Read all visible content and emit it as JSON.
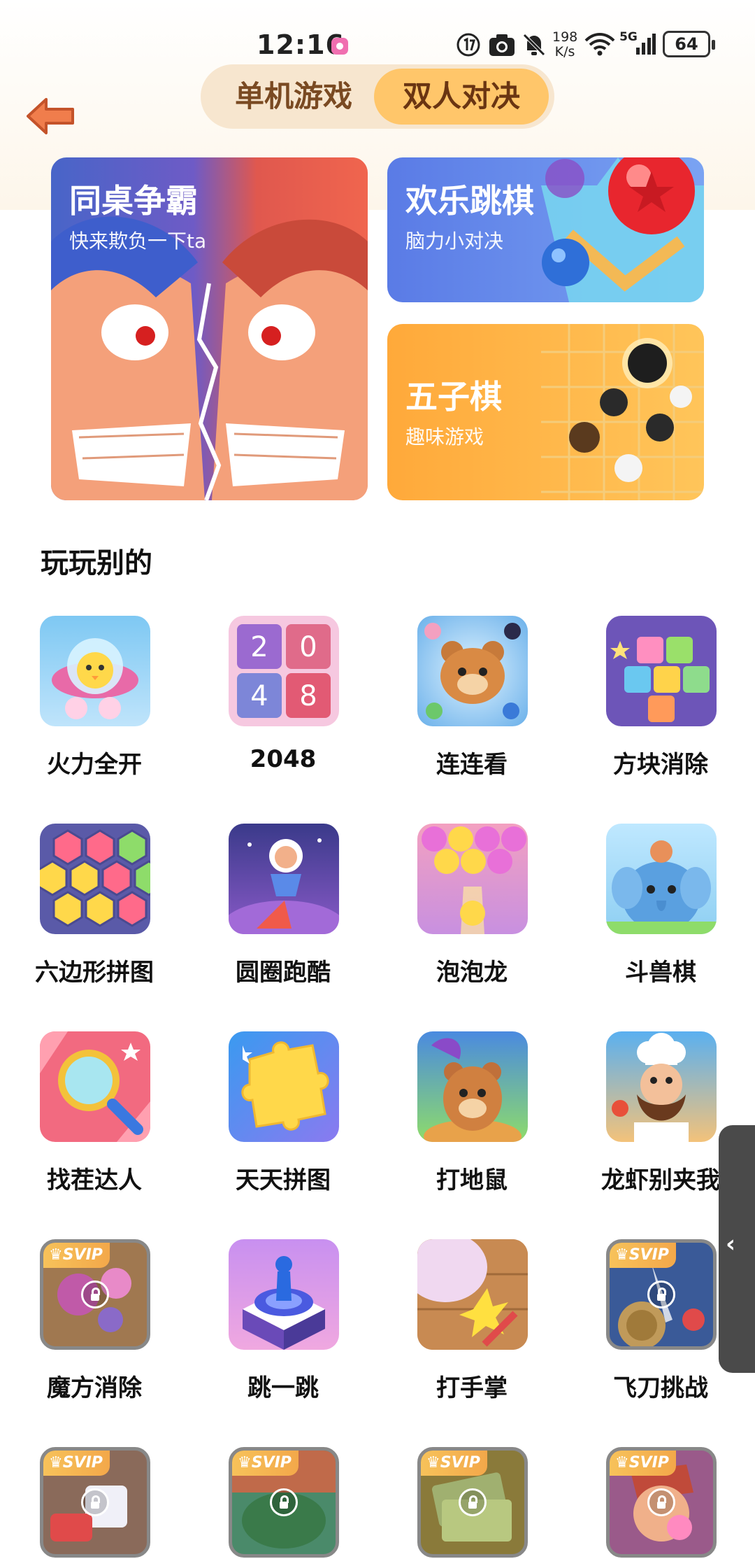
{
  "status_bar": {
    "time": "12:16",
    "net_speed_value": "198",
    "net_speed_unit": "K/s",
    "network": "5G",
    "battery": "64"
  },
  "header": {
    "tabs": [
      {
        "label": "单机游戏",
        "selected": false
      },
      {
        "label": "双人对决",
        "selected": true
      }
    ]
  },
  "featured": [
    {
      "title": "同桌争霸",
      "subtitle": "快来欺负一下ta"
    },
    {
      "title": "欢乐跳棋",
      "subtitle": "脑力小对决"
    },
    {
      "title": "五子棋",
      "subtitle": "趣味游戏"
    }
  ],
  "section": {
    "title": "玩玩别的"
  },
  "badge_text": "SVIP",
  "games": [
    {
      "label": "火力全开",
      "icon": "chick-spaceship-icon",
      "locked": false
    },
    {
      "label": "2048",
      "icon": "2048-tiles-icon",
      "locked": false
    },
    {
      "label": "连连看",
      "icon": "bear-match-icon",
      "locked": false
    },
    {
      "label": "方块消除",
      "icon": "colorful-blocks-icon",
      "locked": false
    },
    {
      "label": "六边形拼图",
      "icon": "hexagon-puzzle-icon",
      "locked": false
    },
    {
      "label": "圆圈跑酷",
      "icon": "astronaut-run-icon",
      "locked": false
    },
    {
      "label": "泡泡龙",
      "icon": "bubble-shooter-icon",
      "locked": false
    },
    {
      "label": "斗兽棋",
      "icon": "elephant-icon",
      "locked": false
    },
    {
      "label": "找茬达人",
      "icon": "magnifier-icon",
      "locked": false
    },
    {
      "label": "天天拼图",
      "icon": "jigsaw-piece-icon",
      "locked": false
    },
    {
      "label": "打地鼠",
      "icon": "mole-icon",
      "locked": false
    },
    {
      "label": "龙虾别夹我",
      "icon": "chef-icon",
      "locked": false
    },
    {
      "label": "魔方消除",
      "icon": "virus-cube-icon",
      "locked": true
    },
    {
      "label": "跳一跳",
      "icon": "jump-stack-icon",
      "locked": false
    },
    {
      "label": "打手掌",
      "icon": "slap-hand-icon",
      "locked": false
    },
    {
      "label": "飞刀挑战",
      "icon": "flying-knife-icon",
      "locked": true
    },
    {
      "label": "",
      "icon": "rabbit-car-icon",
      "locked": true
    },
    {
      "label": "",
      "icon": "crocodile-icon",
      "locked": true
    },
    {
      "label": "",
      "icon": "money-icon",
      "locked": true
    },
    {
      "label": "",
      "icon": "bubblegum-boy-icon",
      "locked": true
    }
  ]
}
